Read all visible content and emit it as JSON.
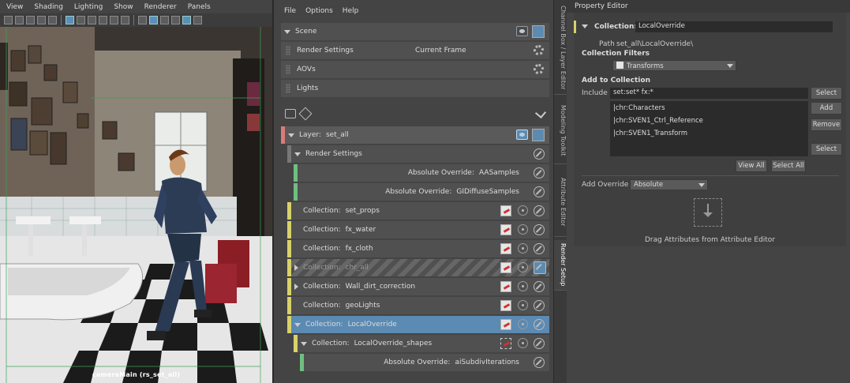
{
  "viewport": {
    "menu": [
      "View",
      "Shading",
      "Lighting",
      "Show",
      "Renderer",
      "Panels"
    ],
    "camera_label": "cameraMain (rs_set_all)"
  },
  "render_setup": {
    "menu": [
      "File",
      "Options",
      "Help"
    ],
    "top_rows": [
      {
        "label": "Scene"
      },
      {
        "label": "Render Settings",
        "value": "Current Frame"
      },
      {
        "label": "AOVs"
      },
      {
        "label": "Lights"
      }
    ],
    "layer": {
      "prefix": "Layer:",
      "name": "set_all"
    },
    "tree": [
      {
        "kind": "group",
        "label": "Render Settings",
        "name": ""
      },
      {
        "kind": "override",
        "prefix": "Absolute Override:",
        "name": "AASamples"
      },
      {
        "kind": "override",
        "prefix": "Absolute Override:",
        "name": "GIDiffuseSamples"
      },
      {
        "kind": "collection",
        "prefix": "Collection:",
        "name": "set_props"
      },
      {
        "kind": "collection",
        "prefix": "Collection:",
        "name": "fx_water"
      },
      {
        "kind": "collection",
        "prefix": "Collection:",
        "name": "fx_cloth"
      },
      {
        "kind": "collection",
        "prefix": "Collection:",
        "name": "chr_all",
        "disabled": true
      },
      {
        "kind": "collection",
        "prefix": "Collection:",
        "name": "Wall_dirt_correction"
      },
      {
        "kind": "collection",
        "prefix": "Collection:",
        "name": "geoLights"
      },
      {
        "kind": "collection",
        "prefix": "Collection:",
        "name": "LocalOverride",
        "selected": true
      },
      {
        "kind": "subcollection",
        "prefix": "Collection:",
        "name": "LocalOverride_shapes"
      },
      {
        "kind": "suboverride",
        "prefix": "Absolute Override:",
        "name": "aiSubdivIterations"
      }
    ]
  },
  "vertical_tabs": [
    "Channel Box / Layer Editor",
    "Modeling Toolkit",
    "Attribute Editor",
    "Render Setup"
  ],
  "property_editor": {
    "title": "Property Editor",
    "collection_label": "Collection:",
    "collection_value": "LocalOverride",
    "path_label": "Path",
    "path_value": "set_all\\LocalOverride\\",
    "filters_heading": "Collection Filters",
    "filter_value": "Transforms",
    "add_heading": "Add to Collection",
    "include_label": "Include",
    "include_value": "set:set* fx:*",
    "members": [
      "|chr:Characters",
      "|chr:SVEN1_Ctrl_Reference",
      "|chr:SVEN1_Transform"
    ],
    "buttons": {
      "select1": "Select",
      "add": "Add",
      "remove": "Remove",
      "select2": "Select",
      "view_all": "View All",
      "select_all": "Select All"
    },
    "add_override_label": "Add Override",
    "add_override_value": "Absolute",
    "drag_hint": "Drag Attributes from Attribute Editor"
  }
}
